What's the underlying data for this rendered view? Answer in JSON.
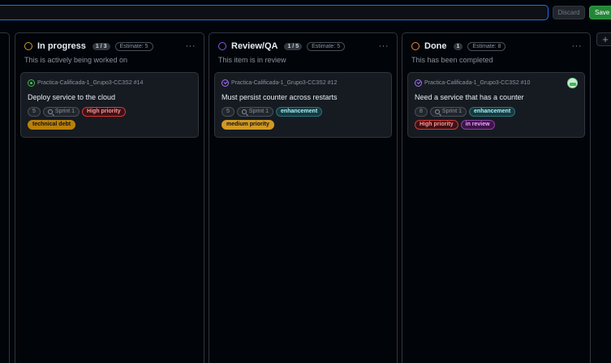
{
  "toolbar": {
    "filter_value": "",
    "discard_label": "Discard",
    "save_label": "Save"
  },
  "add_column_label": "+",
  "colors": {
    "in_progress": "#d29922",
    "review": "#8957e5",
    "done": "#f0883e",
    "accent": "#1f6feb"
  },
  "columns": [
    {
      "title": "In progress",
      "count": "1 / 3",
      "estimate": "Estimate: 5",
      "description": "This is actively being worked on",
      "more": "···",
      "card": {
        "ref": "Practica-Calificada-1_Grupo3-CC3S2 #14",
        "ref_icon": "issue-open-icon",
        "title": "Deploy service to the cloud",
        "number": "5",
        "sprint": "Sprint 1",
        "labels_row1": [
          "High priority"
        ],
        "labels_row2": [
          "technical debt"
        ]
      }
    },
    {
      "title": "Review/QA",
      "count": "1 / 5",
      "estimate": "Estimate: 5",
      "description": "This item is in review",
      "more": "···",
      "card": {
        "ref": "Practica-Calificada-1_Grupo3-CC3S2 #12",
        "ref_icon": "issue-closed-icon",
        "title": "Must persist counter across restarts",
        "number": "5",
        "sprint": "Sprint 1",
        "labels_row1": [
          "enhancement"
        ],
        "labels_row2": [
          "medium priority"
        ]
      }
    },
    {
      "title": "Done",
      "count": "1",
      "estimate": "Estimate: 8",
      "description": "This has been completed",
      "more": "···",
      "card": {
        "ref": "Practica-Calificada-1_Grupo3-CC3S2 #10",
        "ref_icon": "issue-closed-icon",
        "title": "Need a service that has a counter",
        "number": "8",
        "sprint": "Sprint 1",
        "labels_row1": [
          "enhancement"
        ],
        "labels_row2": [
          "High priority",
          "in review"
        ]
      }
    }
  ]
}
